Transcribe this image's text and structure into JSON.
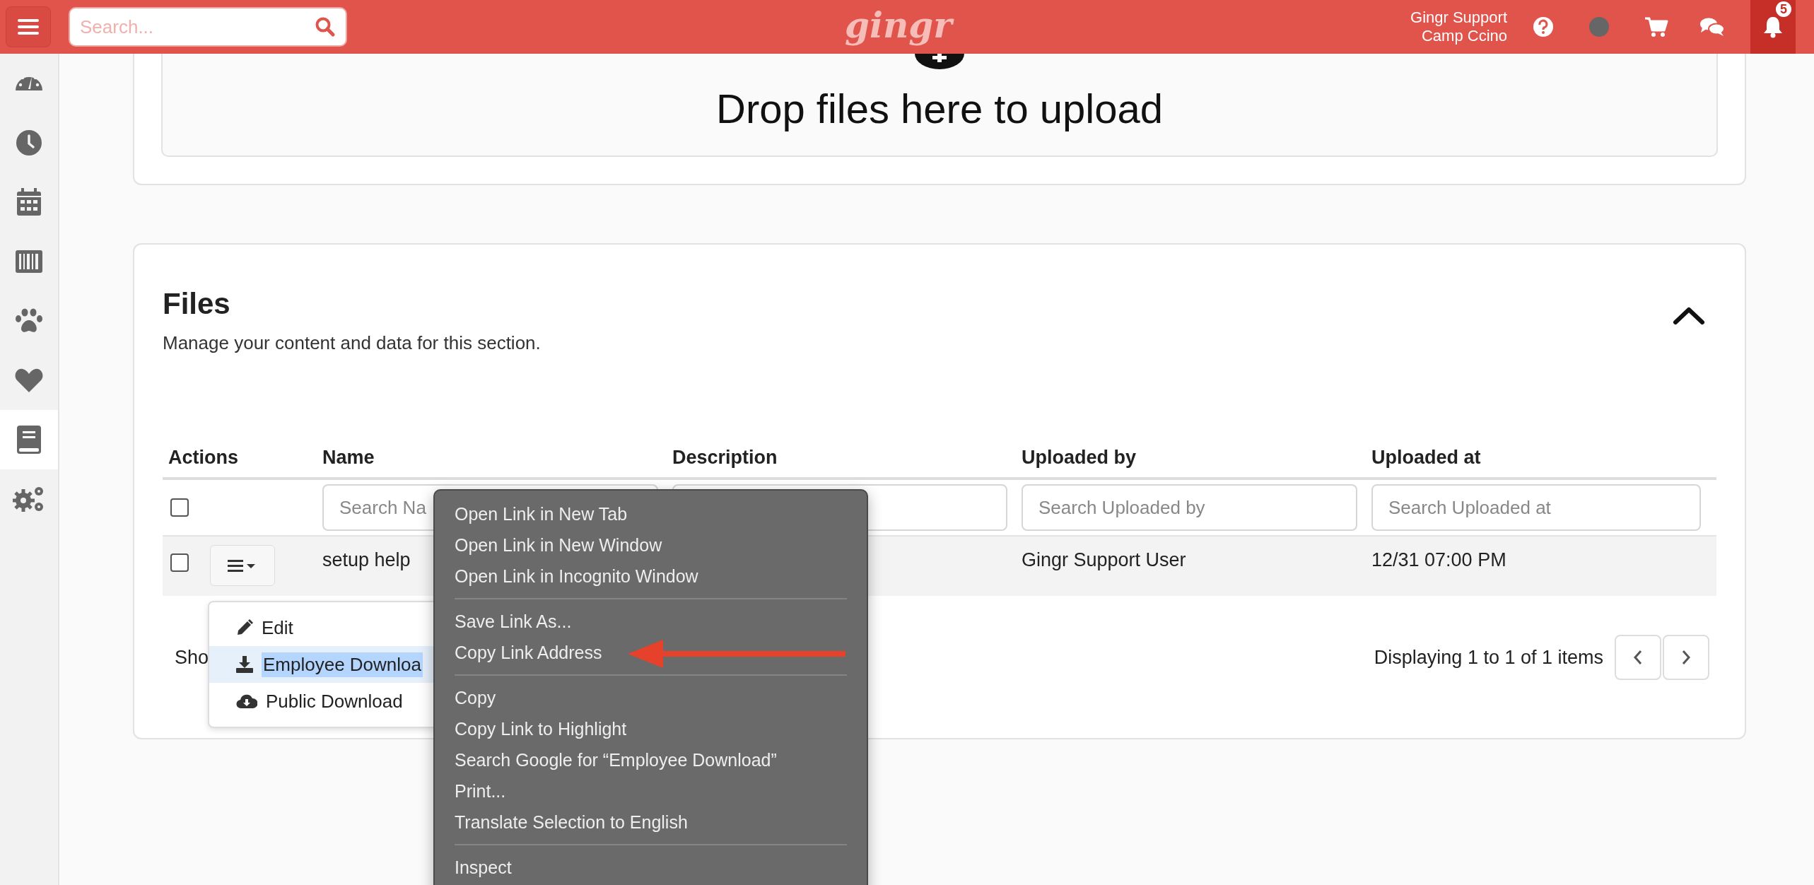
{
  "topbar": {
    "search": {
      "placeholder": "Search..."
    },
    "logo": "gingr",
    "user": {
      "name": "Gingr Support",
      "location": "Camp Ccino"
    },
    "notifications": {
      "count": "5"
    }
  },
  "sidebar": {
    "items": [
      {
        "kind": "dashboard",
        "selected": false
      },
      {
        "kind": "clock",
        "selected": false
      },
      {
        "kind": "calendar",
        "selected": false
      },
      {
        "kind": "barcode",
        "selected": false
      },
      {
        "kind": "paw",
        "selected": false
      },
      {
        "kind": "heart",
        "selected": false
      },
      {
        "kind": "book",
        "selected": true
      },
      {
        "kind": "gears",
        "selected": false
      }
    ]
  },
  "upload": {
    "prompt": "Drop files here to upload"
  },
  "files": {
    "title": "Files",
    "subtitle": "Manage your content and data for this section.",
    "columns": [
      "Actions",
      "Name",
      "Description",
      "Uploaded by",
      "Uploaded at"
    ],
    "select_all_checked": false,
    "name_filter": {
      "placeholder": "Search Na"
    },
    "uploaded_by_filter": {
      "placeholder": "Search Uploaded by"
    },
    "uploaded_at_filter": {
      "placeholder": "Search Uploaded at"
    },
    "rows": [
      {
        "checked": false,
        "name": "setup help",
        "uploaded_by": "Gingr Support User",
        "uploaded_at": "12/31 07:00 PM"
      }
    ],
    "footer": {
      "show_text": "Sho",
      "summary": "Displaying 1 to 1 of 1 items"
    }
  },
  "action_menu": {
    "items": [
      {
        "kind": "edit",
        "label": "Edit",
        "selected": false
      },
      {
        "kind": "employee-download",
        "label": "Employee Downloa",
        "selected": true
      },
      {
        "kind": "public-download",
        "label": "Public Download",
        "selected": false
      }
    ]
  },
  "context_menu": {
    "groups": [
      {
        "items": [
          "Open Link in New Tab",
          "Open Link in New Window",
          "Open Link in Incognito Window"
        ]
      },
      {
        "items": [
          "Save Link As...",
          "Copy Link Address"
        ]
      },
      {
        "items": [
          "Copy",
          "Copy Link to Highlight",
          "Search Google for “Employee Download”",
          "Print...",
          "Translate Selection to English"
        ]
      },
      {
        "items": [
          "Inspect"
        ]
      }
    ]
  }
}
